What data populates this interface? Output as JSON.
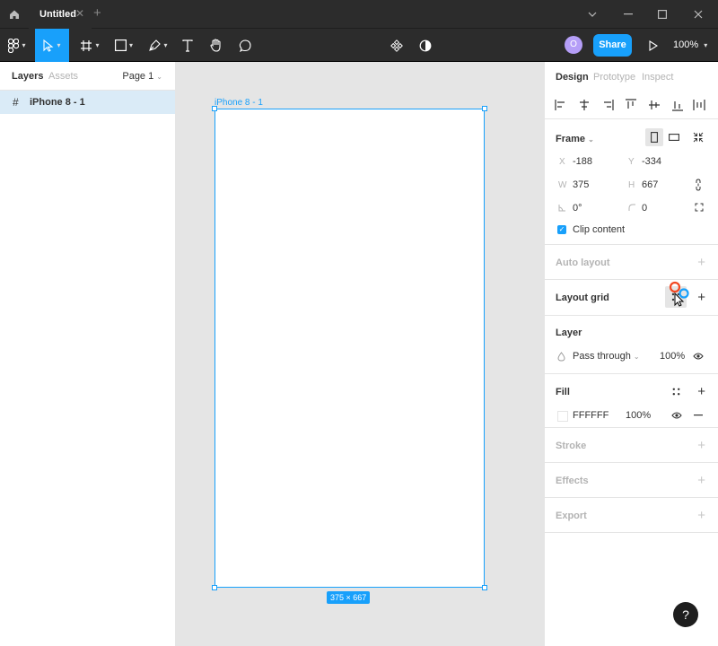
{
  "tabbar": {
    "tab_title": "Untitled",
    "close_glyph": "✕",
    "plus_glyph": "+"
  },
  "toolbar": {
    "avatar_initial": "O",
    "share_label": "Share",
    "zoom": "100%"
  },
  "left_panel": {
    "tabs": [
      "Layers",
      "Assets"
    ],
    "page": "Page 1",
    "layers": [
      {
        "name": "iPhone 8 - 1",
        "icon": "frame-hash-icon"
      }
    ]
  },
  "canvas": {
    "frame_name": "iPhone 8 - 1",
    "frame_dims": "375 × 667",
    "background": "#e5e5e5",
    "selection_color": "#18a0fb"
  },
  "right_panel": {
    "tabs": [
      "Design",
      "Prototype",
      "Inspect"
    ],
    "frame": {
      "title": "Frame",
      "x_label": "X",
      "x": "-188",
      "y_label": "Y",
      "y": "-334",
      "w_label": "W",
      "w": "375",
      "h_label": "H",
      "h": "667",
      "rotation": "0°",
      "radius": "0",
      "clip_label": "Clip content"
    },
    "auto_layout": "Auto layout",
    "layout_grid": "Layout grid",
    "layer": {
      "title": "Layer",
      "blend": "Pass through",
      "opacity": "100%"
    },
    "fill": {
      "title": "Fill",
      "hex": "FFFFFF",
      "opacity": "100%"
    },
    "stroke": "Stroke",
    "effects": "Effects",
    "export": "Export"
  },
  "help_label": "?"
}
